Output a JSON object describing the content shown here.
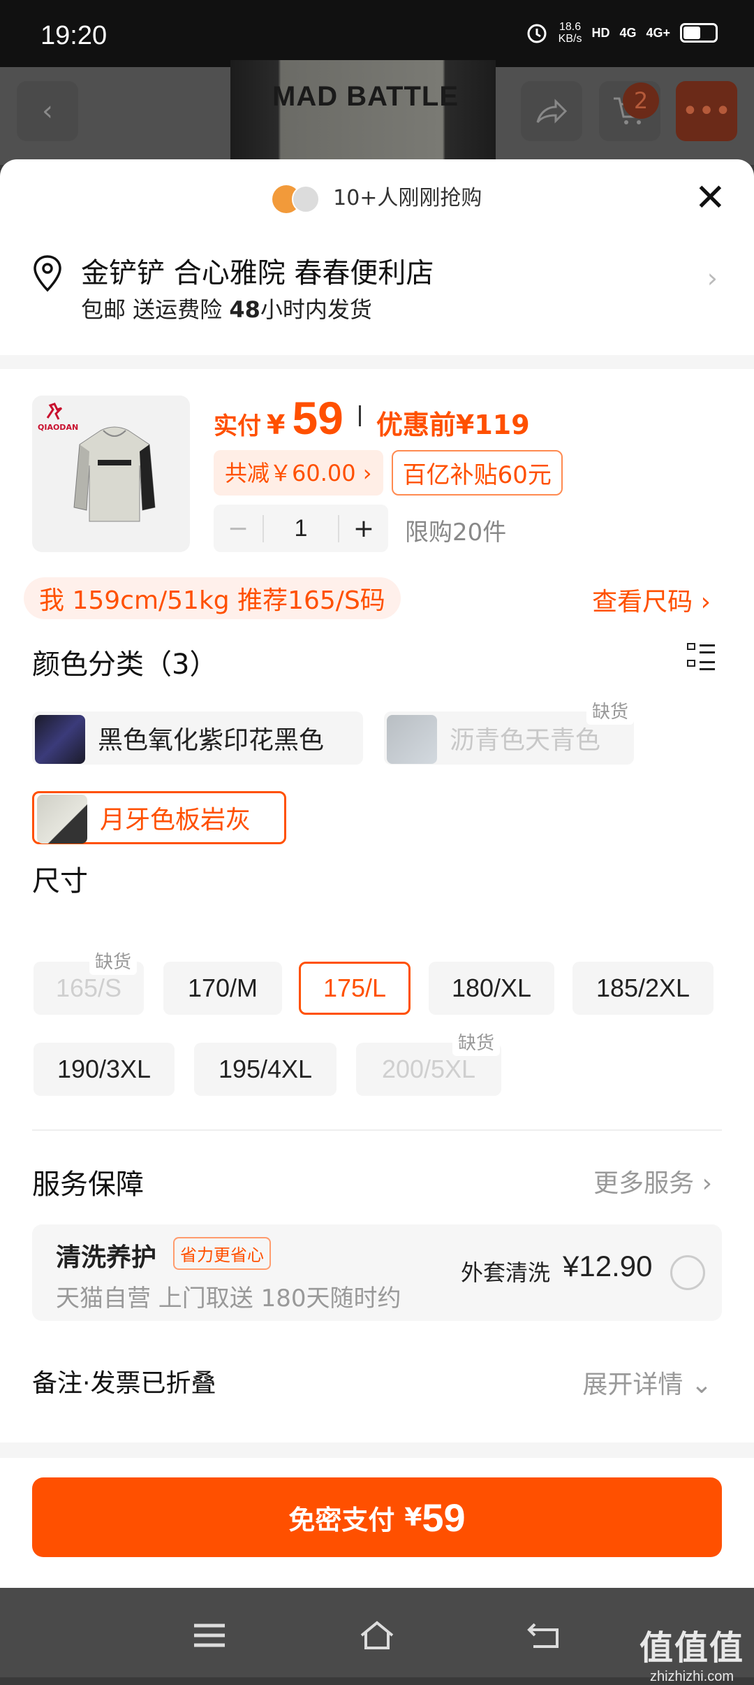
{
  "status_bar": {
    "time": "19:20",
    "net_speed": "18.6",
    "net_unit": "KB/s",
    "hd": "HD",
    "sim1": "4G",
    "sim2": "4G+"
  },
  "backdrop": {
    "hero_text": "MAD BATTLE",
    "cart_count": "2"
  },
  "sheet": {
    "buyers_text": "10+人刚刚抢购",
    "address": {
      "line1": "金铲铲 合心雅院 春春便利店",
      "line2_a": "包邮 送运费险 ",
      "line2_b": "48",
      "line2_c": "小时内发货"
    },
    "product": {
      "brand": "QIAODAN",
      "pay_label": "实付",
      "pay_symbol": "¥",
      "pay_amount": "59",
      "before_price": "优惠前¥119",
      "discount_tag": "共减￥60.00 ›",
      "subsidy_tag": "百亿补贴60元",
      "quantity": "1",
      "limit": "限购20件"
    },
    "recommend": {
      "text": "我 159cm/51kg 推荐165/S码",
      "size_chart": "查看尺码 ›"
    },
    "color": {
      "title": "颜色分类（3）",
      "options": [
        {
          "label": "黑色氧化紫印花黑色",
          "state": "normal"
        },
        {
          "label": "沥青色天青色",
          "state": "out_of_stock",
          "badge": "缺货"
        },
        {
          "label": "月牙色板岩灰",
          "state": "selected"
        }
      ]
    },
    "size": {
      "title": "尺寸",
      "options": [
        {
          "label": "165/S",
          "state": "out_of_stock",
          "badge": "缺货"
        },
        {
          "label": "170/M",
          "state": "normal"
        },
        {
          "label": "175/L",
          "state": "selected"
        },
        {
          "label": "180/XL",
          "state": "normal"
        },
        {
          "label": "185/2XL",
          "state": "normal"
        },
        {
          "label": "190/3XL",
          "state": "normal"
        },
        {
          "label": "195/4XL",
          "state": "normal"
        },
        {
          "label": "200/5XL",
          "state": "out_of_stock",
          "badge": "缺货"
        }
      ]
    },
    "service": {
      "title": "服务保障",
      "more": "更多服务 ›",
      "card": {
        "name": "清洗养护",
        "tag": "省力更省心",
        "desc": "天猫自营 上门取送 180天随时约",
        "price_label": "外套清洗",
        "price": "¥12.90"
      }
    },
    "notes": {
      "title": "备注·发票已折叠",
      "expand": "展开详情 ⌄"
    },
    "pay_button": {
      "text": "免密支付",
      "symbol": "¥",
      "amount": "59"
    }
  },
  "watermark": {
    "big": "值值值",
    "small": "zhizhizhi.com"
  },
  "colors": {
    "accent": "#ff5000",
    "accent_bg": "#fff0eb"
  }
}
